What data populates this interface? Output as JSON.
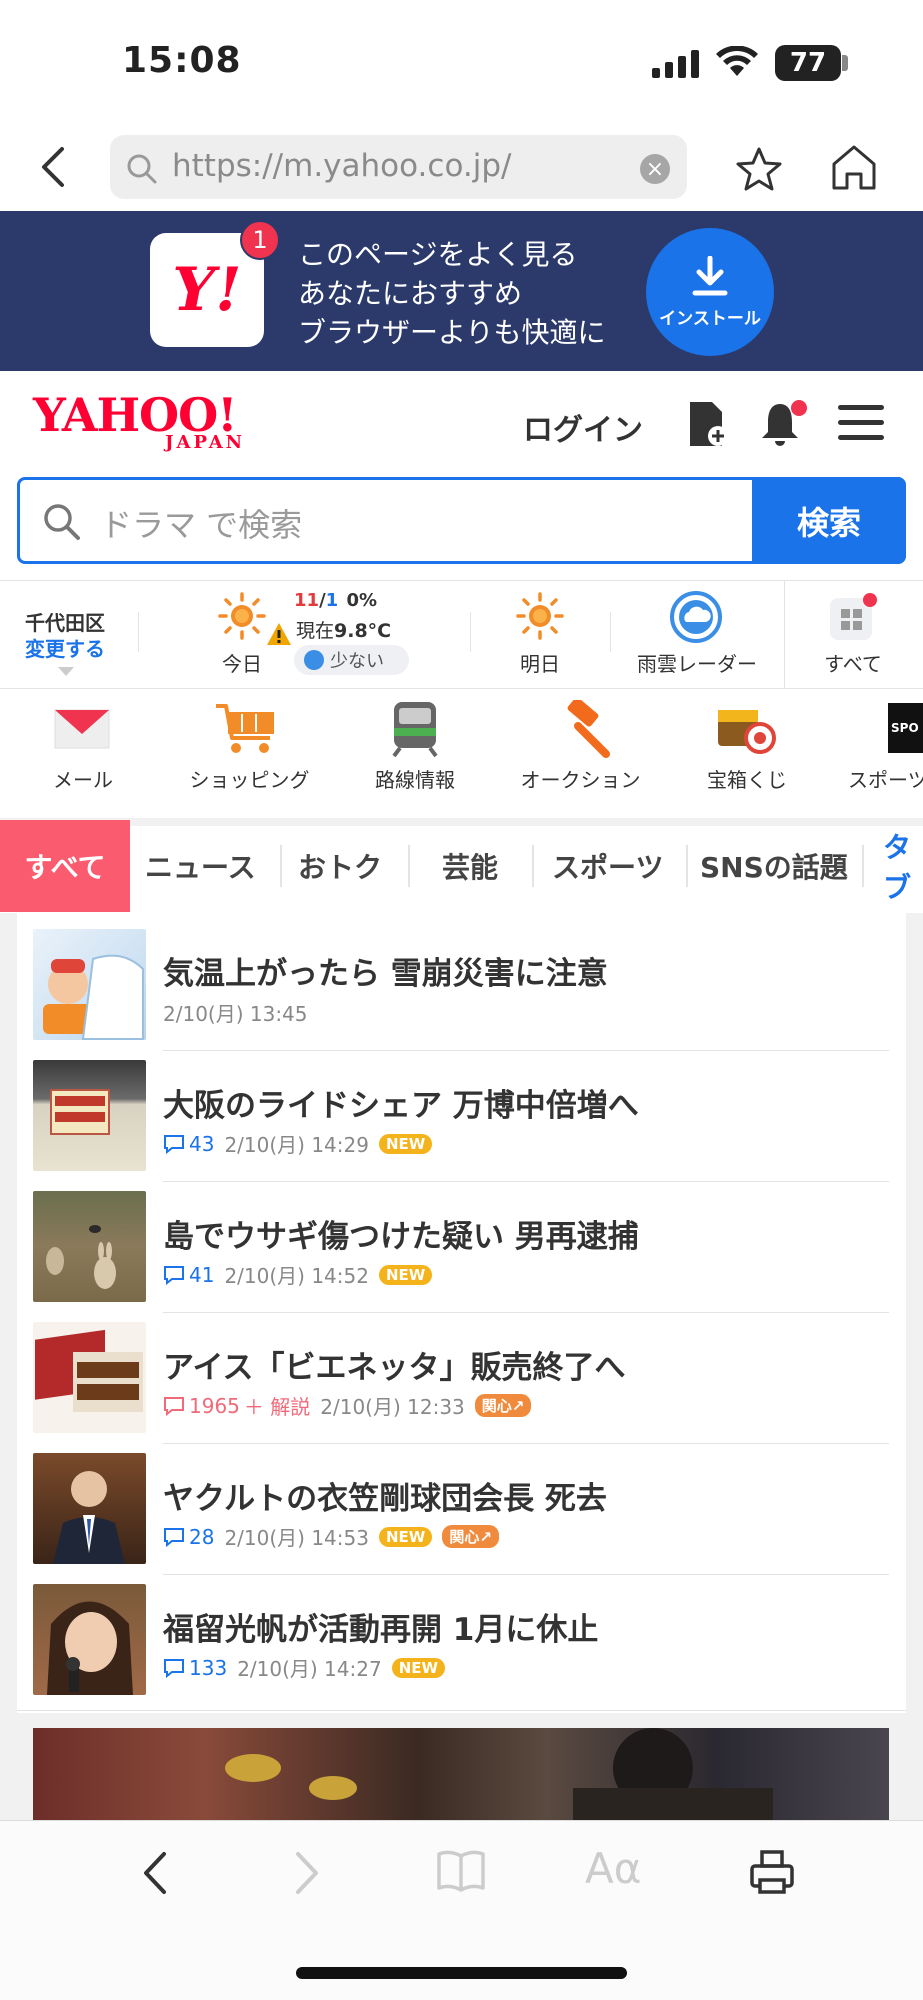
{
  "status_bar": {
    "time": "15:08",
    "battery": "77"
  },
  "browser": {
    "url": "https://m.yahoo.co.jp/"
  },
  "banner": {
    "badge_count": "1",
    "lines": [
      "このページをよく見る",
      "あなたにおすすめ",
      "ブラウザーよりも快適に"
    ],
    "install_label": "インストール"
  },
  "header": {
    "logo": "YAHOO!",
    "logo_sub": "JAPAN",
    "login": "ログイン"
  },
  "search": {
    "placeholder": "ドラマ で検索",
    "button": "検索"
  },
  "weather": {
    "location": "千代田区",
    "change": "変更する",
    "today": "今日",
    "date_month": "11",
    "date_sep": "/",
    "date_day": "1",
    "precip": "0%",
    "now_label": "現在",
    "now_temp": "9.8°C",
    "pollen": "少ない",
    "tomorrow": "明日",
    "radar": "雨雲レーダー",
    "all": "すべて"
  },
  "services": [
    {
      "label": "メール"
    },
    {
      "label": "ショッピング"
    },
    {
      "label": "路線情報"
    },
    {
      "label": "オークション"
    },
    {
      "label": "宝箱くじ"
    },
    {
      "label": "スポーツ"
    }
  ],
  "tabs": [
    "すべて",
    "ニュース",
    "おトク",
    "芸能",
    "スポーツ",
    "SNSの話題",
    "タブ"
  ],
  "news": [
    {
      "title": "気温上がったら 雪崩災害に注意",
      "comments": "",
      "time": "2/10(月) 13:45",
      "tags": []
    },
    {
      "title": "大阪のライドシェア 万博中倍増へ",
      "comments": "43",
      "time": "2/10(月) 14:29",
      "tags": [
        "NEW"
      ]
    },
    {
      "title": "島でウサギ傷つけた疑い 男再逮捕",
      "comments": "41",
      "time": "2/10(月) 14:52",
      "tags": [
        "NEW"
      ]
    },
    {
      "title": "アイス「ビエネッタ」販売終了へ",
      "comments": "1965",
      "extra": "＋ 解説",
      "time": "2/10(月) 12:33",
      "tags": [
        "関心"
      ]
    },
    {
      "title": "ヤクルトの衣笠剛球団会長 死去",
      "comments": "28",
      "time": "2/10(月) 14:53",
      "tags": [
        "NEW",
        "関心"
      ]
    },
    {
      "title": "福留光帆が活動再開 1月に休止",
      "comments": "133",
      "time": "2/10(月) 14:27",
      "tags": [
        "NEW"
      ]
    }
  ],
  "colors": {
    "brand_red": "#ff0033",
    "accent_blue": "#1a73e8",
    "banner_bg": "#2c3a6b",
    "tab_active": "#fb5b6e"
  }
}
